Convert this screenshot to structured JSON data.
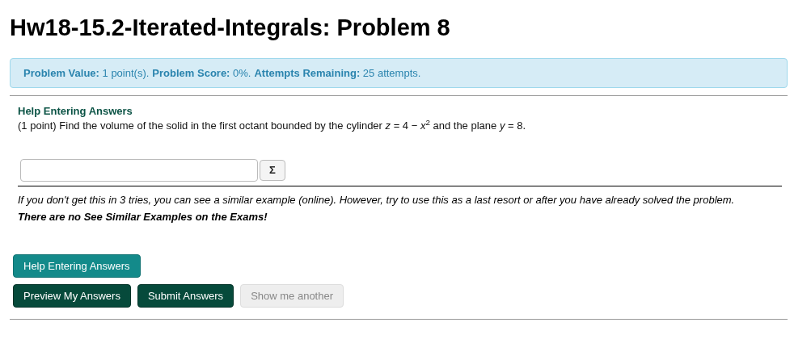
{
  "title": "Hw18-15.2-Iterated-Integrals: Problem 8",
  "info": [
    {
      "label": "Problem Value:",
      "value": "1 point(s)."
    },
    {
      "label": "Problem Score:",
      "value": "0%."
    },
    {
      "label": "Attempts Remaining:",
      "value": "25 attempts."
    }
  ],
  "problem": {
    "help_link": "Help Entering Answers",
    "statement": "(1 point) Find the volume of the solid in the first octant bounded by the cylinder *z* = 4 − *x*$^{2}$ and the plane *y* = 8.",
    "answer": {
      "symbol_button": "Σ"
    }
  },
  "note": "If you don't get this in 3 tries, you can see a similar example (online). However, try to use this as a last resort or after you have already solved the problem. **There are no See Similar Examples on the Exams!**",
  "help_button": "Help Entering Answers",
  "buttons": [
    {
      "label": "Preview My Answers",
      "disabled": false
    },
    {
      "label": "Submit Answers",
      "disabled": false
    },
    {
      "label": "Show me another",
      "disabled": true
    }
  ]
}
